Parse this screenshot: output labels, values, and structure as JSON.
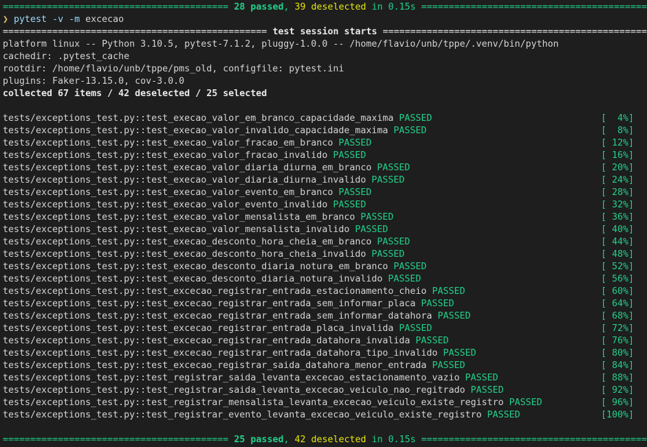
{
  "top_summary": {
    "passed": "28 passed",
    "sep": ", ",
    "deselected": "39 deselected",
    "time": " in 0.15s "
  },
  "prompt": {
    "arrow": "❯",
    "command": "pytest -v -m",
    "arg": "excecao"
  },
  "session_header": "test session starts",
  "info_lines": [
    "platform linux -- Python 3.10.5, pytest-7.1.2, pluggy-1.0.0 -- /home/flavio/unb/tppe/.venv/bin/python",
    "cachedir: .pytest_cache",
    "rootdir: /home/flavio/unb/tppe/pms_old, configfile: pytest.ini",
    "plugins: Faker-13.15.0, cov-3.0.0"
  ],
  "collected": "collected 67 items / 42 deselected / 25 selected",
  "status_label": "PASSED",
  "tests": [
    {
      "name": "tests/exceptions_test.py::test_execao_valor_em_branco_capacidade_maxima",
      "pct": "[  4%]"
    },
    {
      "name": "tests/exceptions_test.py::test_execao_valor_invalido_capacidade_maxima",
      "pct": "[  8%]"
    },
    {
      "name": "tests/exceptions_test.py::test_execao_valor_fracao_em_branco",
      "pct": "[ 12%]"
    },
    {
      "name": "tests/exceptions_test.py::test_execao_valor_fracao_invalido",
      "pct": "[ 16%]"
    },
    {
      "name": "tests/exceptions_test.py::test_execao_valor_diaria_diurna_em_branco",
      "pct": "[ 20%]"
    },
    {
      "name": "tests/exceptions_test.py::test_execao_valor_diaria_diurna_invalido",
      "pct": "[ 24%]"
    },
    {
      "name": "tests/exceptions_test.py::test_execao_valor_evento_em_branco",
      "pct": "[ 28%]"
    },
    {
      "name": "tests/exceptions_test.py::test_execao_valor_evento_invalido",
      "pct": "[ 32%]"
    },
    {
      "name": "tests/exceptions_test.py::test_execao_valor_mensalista_em_branco",
      "pct": "[ 36%]"
    },
    {
      "name": "tests/exceptions_test.py::test_execao_valor_mensalista_invalido",
      "pct": "[ 40%]"
    },
    {
      "name": "tests/exceptions_test.py::test_execao_desconto_hora_cheia_em_branco",
      "pct": "[ 44%]"
    },
    {
      "name": "tests/exceptions_test.py::test_execao_desconto_hora_cheia_invalido",
      "pct": "[ 48%]"
    },
    {
      "name": "tests/exceptions_test.py::test_execao_desconto_diaria_notura_em_branco",
      "pct": "[ 52%]"
    },
    {
      "name": "tests/exceptions_test.py::test_execao_desconto_diaria_notura_invalido",
      "pct": "[ 56%]"
    },
    {
      "name": "tests/exceptions_test.py::test_excecao_registrar_entrada_estacionamento_cheio",
      "pct": "[ 60%]"
    },
    {
      "name": "tests/exceptions_test.py::test_excecao_registrar_entrada_sem_informar_placa",
      "pct": "[ 64%]"
    },
    {
      "name": "tests/exceptions_test.py::test_excecao_registrar_entrada_sem_informar_datahora",
      "pct": "[ 68%]"
    },
    {
      "name": "tests/exceptions_test.py::test_excecao_registrar_entrada_placa_invalida",
      "pct": "[ 72%]"
    },
    {
      "name": "tests/exceptions_test.py::test_excecao_registrar_entrada_datahora_invalida",
      "pct": "[ 76%]"
    },
    {
      "name": "tests/exceptions_test.py::test_excecao_registrar_entrada_datahora_tipo_invalido",
      "pct": "[ 80%]"
    },
    {
      "name": "tests/exceptions_test.py::test_excecao_registrar_saida_datahora_menor_entrada",
      "pct": "[ 84%]"
    },
    {
      "name": "tests/exceptions_test.py::test_registrar_saida_levanta_excecao_estacionamento_vazio",
      "pct": "[ 88%]"
    },
    {
      "name": "tests/exceptions_test.py::test_registrar_saida_levanta_excecao_veiculo_nao_regitrado",
      "pct": "[ 92%]"
    },
    {
      "name": "tests/exceptions_test.py::test_registrar_mensalista_levanta_excecao_veiculo_existe_registro",
      "pct": "[ 96%]"
    },
    {
      "name": "tests/exceptions_test.py::test_registrar_evento_levanta_excecao_veiculo_existe_registro",
      "pct": "[100%]"
    }
  ],
  "bottom_summary": {
    "passed": "25 passed",
    "sep": ", ",
    "deselected": "42 deselected",
    "time": " in 0.15s "
  },
  "colors": {
    "background": "#1e1e1e",
    "pass_green": "#23d18b",
    "deselect_yellow": "#e5e510",
    "text": "#d4d4d4"
  }
}
